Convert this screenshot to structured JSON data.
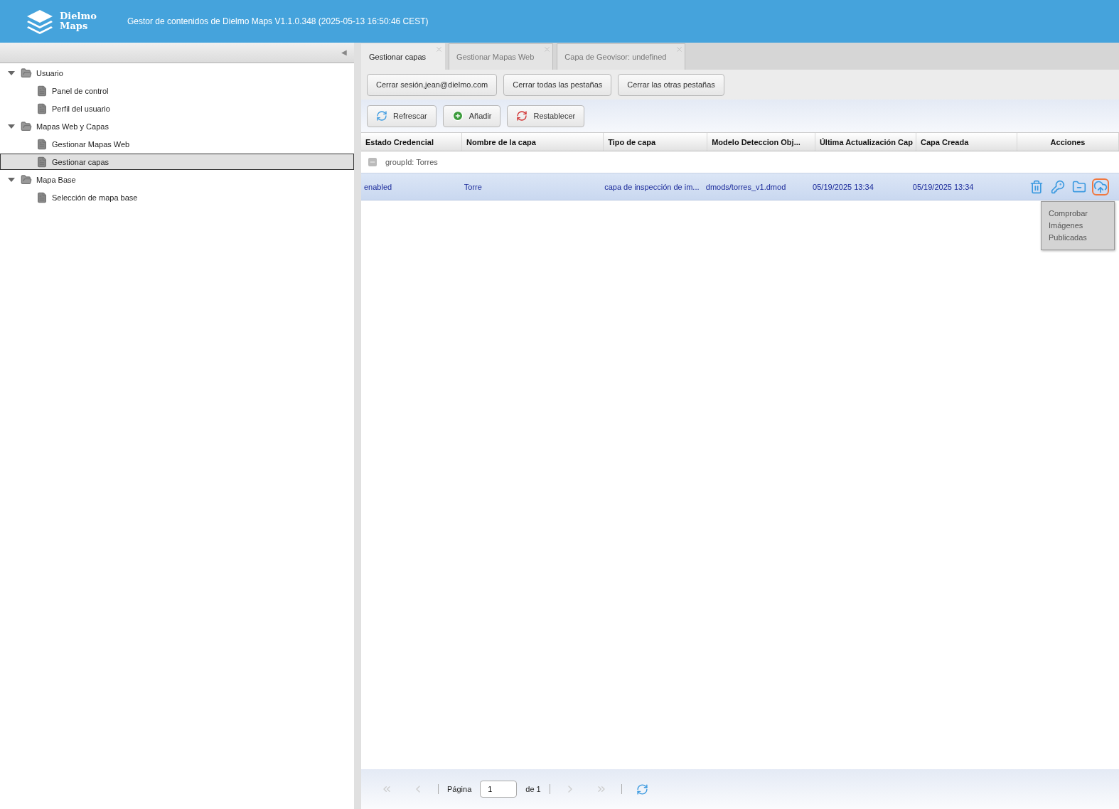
{
  "header": {
    "logo_text": "Dielmo Maps",
    "title": "Gestor de contenidos de Dielmo Maps V1.1.0.348 (2025-05-13 16:50:46 CEST)"
  },
  "sidebar": {
    "collapse_arrow": "◀",
    "tree": [
      {
        "label": "Usuario",
        "expanded": true,
        "selected": false,
        "children": [
          {
            "label": "Panel de control",
            "selected": false
          },
          {
            "label": "Perfil del usuario",
            "selected": false
          }
        ]
      },
      {
        "label": "Mapas Web y Capas",
        "expanded": true,
        "selected": false,
        "children": [
          {
            "label": "Gestionar Mapas Web",
            "selected": false
          },
          {
            "label": "Gestionar capas",
            "selected": true
          }
        ]
      },
      {
        "label": "Mapa Base",
        "expanded": true,
        "selected": false,
        "children": [
          {
            "label": "Selección de mapa base",
            "selected": false
          }
        ]
      }
    ]
  },
  "tabs": [
    {
      "label": "Gestionar capas",
      "selected": true
    },
    {
      "label": "Gestionar Mapas Web",
      "selected": false
    },
    {
      "label": "Capa de Geovisor: undefined",
      "selected": false
    }
  ],
  "session_buttons": [
    "Cerrar sesión,jean@dielmo.com",
    "Cerrar todas las pestañas",
    "Cerrar las otras pestañas"
  ],
  "toolbar": [
    {
      "kind": "refresh",
      "label": "Refrescar"
    },
    {
      "kind": "add",
      "label": "Añadir"
    },
    {
      "kind": "reset",
      "label": "Restablecer"
    }
  ],
  "table": {
    "columns": [
      "Estado Credencial",
      "Nombre de la capa",
      "Tipo de capa",
      "Modelo Deteccion Obj...",
      "Última Actualización Cap",
      "Capa Creada",
      "Acciones"
    ],
    "group": {
      "label": "groupId: Torres",
      "expanded": true
    },
    "rows": [
      {
        "selected": true,
        "cells": [
          "enabled",
          "Torre",
          "capa de inspección de im...",
          "dmods/torres_v1.dmod",
          "05/19/2025 13:34",
          "05/19/2025 13:34"
        ],
        "actions": [
          {
            "kind": "delete",
            "highlighted": false
          },
          {
            "kind": "key",
            "highlighted": false
          },
          {
            "kind": "folder",
            "highlighted": false
          },
          {
            "kind": "upload",
            "highlighted": true
          }
        ]
      }
    ]
  },
  "tooltip": "Comprobar Imágenes Publicadas",
  "pager": {
    "page_label": "Página",
    "page_value": "1",
    "of_label": "de 1",
    "first_disabled": true,
    "prev_disabled": true,
    "next_disabled": true,
    "last_disabled": true
  }
}
